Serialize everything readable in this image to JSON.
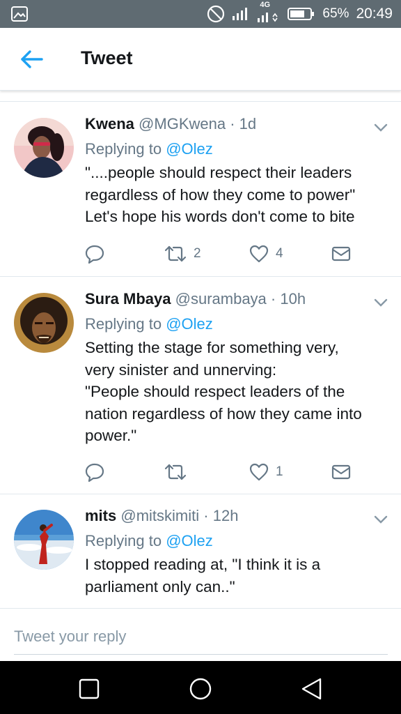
{
  "status_bar": {
    "network": "4G",
    "battery": "65%",
    "time": "20:49"
  },
  "header": {
    "title": "Tweet"
  },
  "tweets": [
    {
      "name": "Kwena",
      "handle": "@MGKwena",
      "time": "1d",
      "replying_prefix": "Replying to",
      "replying_to": "@Olez",
      "text_lines": [
        "\"....people should respect their leaders",
        "regardless of how they come to power\"",
        "Let's hope his words don't come to bite"
      ],
      "retweets": "2",
      "likes": "4"
    },
    {
      "name": "Sura Mbaya",
      "handle": "@surambaya",
      "time": "10h",
      "replying_prefix": "Replying to",
      "replying_to": "@Olez",
      "text_lines": [
        "Setting the stage for something very,",
        "very sinister and unnerving:",
        "\"People should respect leaders of the",
        "nation regardless of how they came into",
        "power.\""
      ],
      "retweets": "",
      "likes": "1"
    },
    {
      "name": "mits",
      "handle": "@mitskimiti",
      "time": "12h",
      "replying_prefix": "Replying to",
      "replying_to": "@Olez",
      "text_lines": [
        "I stopped reading at, \"I think it is a",
        "parliament only can..\""
      ]
    }
  ],
  "composer": {
    "placeholder": "Tweet your reply"
  },
  "icons": {
    "back": "arrow-left-icon",
    "reply": "reply-icon",
    "retweet": "retweet-icon",
    "like": "heart-icon",
    "dm": "envelope-icon",
    "more": "chevron-down-icon"
  },
  "colors": {
    "accent": "#1da1f2",
    "status_bar": "#5f6b72",
    "secondary_text": "#657786"
  }
}
